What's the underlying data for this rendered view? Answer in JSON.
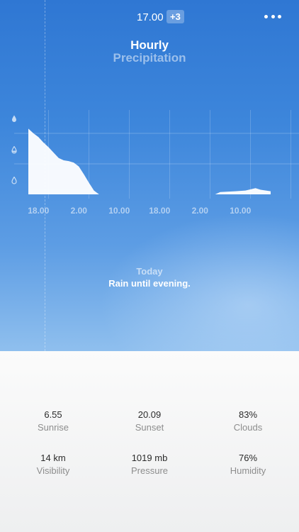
{
  "header": {
    "time": "17.00",
    "badge": "+3"
  },
  "title": "Hourly",
  "subtitle": "Precipitation",
  "chart_data": {
    "type": "area",
    "x_tick_labels": [
      "18.00",
      "2.00",
      "10.00",
      "18.00",
      "2.00",
      "10.00"
    ],
    "x_range_hours": [
      0,
      48
    ],
    "y_levels": [
      "heavy",
      "moderate",
      "light"
    ],
    "ylim": [
      0,
      1
    ],
    "fill_color": "#ffffff",
    "series": [
      {
        "values": [
          {
            "x": 0,
            "y": 0.85
          },
          {
            "x": 1,
            "y": 0.79
          },
          {
            "x": 2,
            "y": 0.74
          },
          {
            "x": 3,
            "y": 0.67
          },
          {
            "x": 4,
            "y": 0.61
          },
          {
            "x": 5,
            "y": 0.54
          },
          {
            "x": 6,
            "y": 0.47
          },
          {
            "x": 7,
            "y": 0.44
          },
          {
            "x": 8,
            "y": 0.43
          },
          {
            "x": 9,
            "y": 0.41
          },
          {
            "x": 10,
            "y": 0.36
          },
          {
            "x": 11,
            "y": 0.26
          },
          {
            "x": 12,
            "y": 0.15
          },
          {
            "x": 13,
            "y": 0.05
          },
          {
            "x": 14,
            "y": 0.0
          },
          {
            "x": 37,
            "y": 0.0
          },
          {
            "x": 38,
            "y": 0.03
          },
          {
            "x": 41,
            "y": 0.04
          },
          {
            "x": 43,
            "y": 0.05
          },
          {
            "x": 45,
            "y": 0.08
          },
          {
            "x": 46,
            "y": 0.06
          },
          {
            "x": 48,
            "y": 0.04
          }
        ]
      }
    ]
  },
  "forecast": {
    "label": "Today",
    "text": "Rain until evening."
  },
  "details": [
    {
      "value": "6.55",
      "label": "Sunrise"
    },
    {
      "value": "20.09",
      "label": "Sunset"
    },
    {
      "value": "83%",
      "label": "Clouds"
    },
    {
      "value": "14 km",
      "label": "Visibility"
    },
    {
      "value": "1019 mb",
      "label": "Pressure"
    },
    {
      "value": "76%",
      "label": "Humidity"
    }
  ],
  "icons": {
    "menu": "more-dots-icon",
    "levels": [
      "drop-full-icon",
      "drop-half-icon",
      "drop-outline-icon"
    ]
  }
}
